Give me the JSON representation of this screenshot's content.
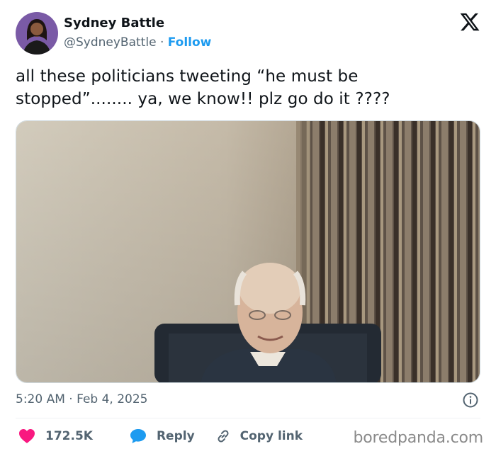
{
  "author": {
    "display_name": "Sydney Battle",
    "handle": "@SydneyBattle",
    "separator": "·",
    "follow_label": "Follow"
  },
  "tweet": {
    "text": "all these politicians tweeting “he must be stopped”........ ya, we know!! plz go do it ????"
  },
  "meta": {
    "time": "5:20 AM",
    "separator": "·",
    "date": "Feb 4, 2025"
  },
  "actions": {
    "likes": "172.5K",
    "reply_label": "Reply",
    "copy_label": "Copy link"
  },
  "icons": {
    "logo": "x-logo-icon",
    "info": "info-icon",
    "like": "heart-icon",
    "reply": "speech-bubble-icon",
    "copy": "link-icon"
  },
  "colors": {
    "follow": "#1d9bf0",
    "heart": "#f91880",
    "reply": "#1d9bf0",
    "muted": "#536471"
  },
  "watermark": "boredpanda.com"
}
